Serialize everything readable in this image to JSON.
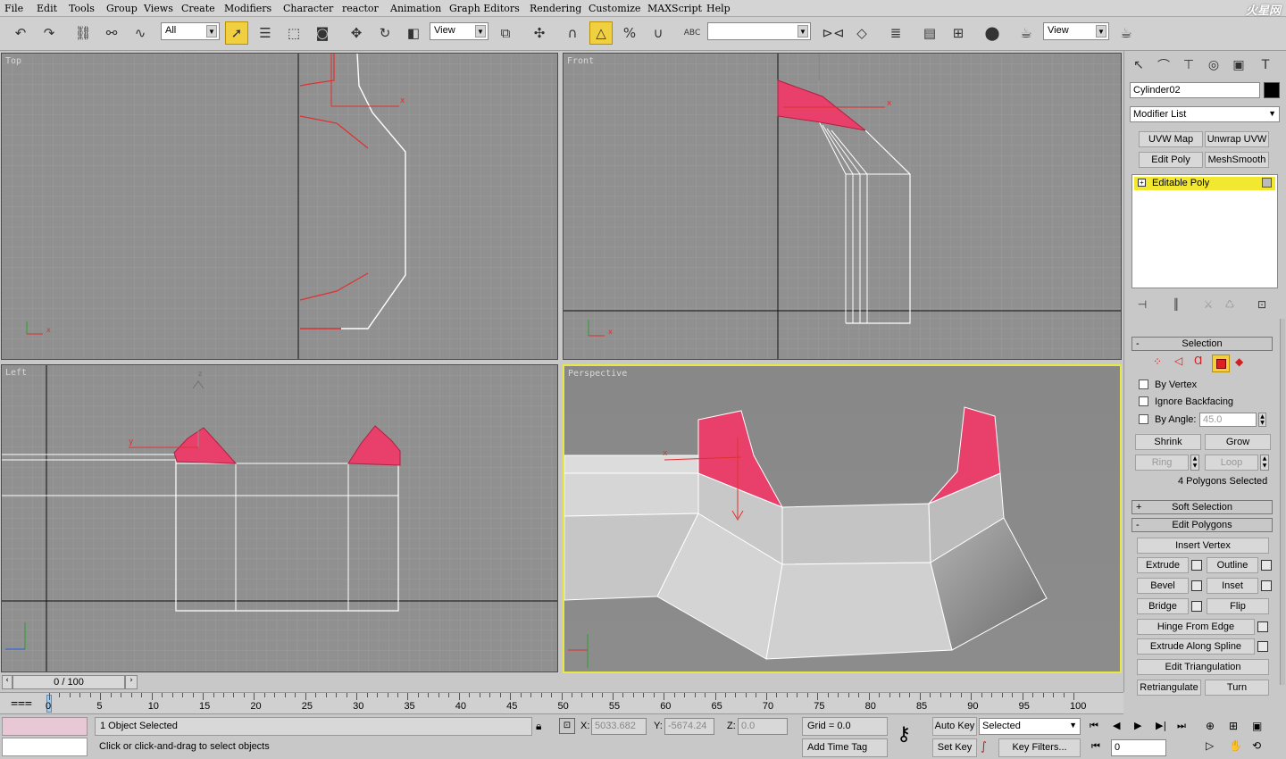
{
  "menu": [
    "File",
    "Edit",
    "Tools",
    "Group",
    "Views",
    "Create",
    "Modifiers",
    "Character",
    "reactor",
    "Animation",
    "Graph Editors",
    "Rendering",
    "Customize",
    "MAXScript",
    "Help"
  ],
  "logo_text": "火星网",
  "toolbar": {
    "selection_filter": "All",
    "ref_coord": "View",
    "named_sel": "",
    "render_view": "View",
    "abc_label": "ABC"
  },
  "viewports": {
    "top": "Top",
    "front": "Front",
    "left": "Left",
    "perspective": "Perspective"
  },
  "axis_labels": {
    "x": "x",
    "y": "y",
    "z": "z"
  },
  "command_panel": {
    "object_name": "Cylinder02",
    "color_swatch": "#000000",
    "modifier_list": "Modifier List",
    "buttons": [
      "UVW Map",
      "Unwrap UVW",
      "Edit Poly",
      "MeshSmooth"
    ],
    "stack_item": "Editable Poly",
    "selection_title": "Selection",
    "by_vertex": "By Vertex",
    "ignore_backfacing": "Ignore Backfacing",
    "by_angle": "By Angle:",
    "angle_value": "45.0",
    "shrink": "Shrink",
    "grow": "Grow",
    "ring": "Ring",
    "loop": "Loop",
    "selected_info": "4 Polygons Selected",
    "soft_selection": "Soft Selection",
    "edit_polygons": "Edit Polygons",
    "insert_vertex": "Insert Vertex",
    "extrude": "Extrude",
    "outline": "Outline",
    "bevel": "Bevel",
    "inset": "Inset",
    "bridge": "Bridge",
    "flip": "Flip",
    "hinge": "Hinge From Edge",
    "extrude_spline": "Extrude Along Spline",
    "edit_tri": "Edit Triangulation",
    "retriangulate": "Retriangulate",
    "turn": "Turn"
  },
  "timeline": {
    "frame": "0 / 100",
    "ticks": [
      "0",
      "5",
      "10",
      "15",
      "20",
      "25",
      "30",
      "35",
      "40",
      "45",
      "50",
      "55",
      "60",
      "65",
      "70",
      "75",
      "80",
      "85",
      "90",
      "95",
      "100"
    ]
  },
  "status": {
    "objects_selected": "1 Object Selected",
    "prompt": "Click or click-and-drag to select objects",
    "x_label": "X:",
    "x_value": "5033.682",
    "y_label": "Y:",
    "y_value": "-5674.24",
    "z_label": "Z:",
    "z_value": "0.0",
    "grid": "Grid = 0.0",
    "add_time_tag": "Add Time Tag",
    "auto_key": "Auto Key",
    "set_key": "Set Key",
    "key_mode": "Selected",
    "key_filters": "Key Filters...",
    "current_frame": "0"
  },
  "colors": {
    "selected_poly": "#e8406a",
    "active_border": "#e8e840",
    "viewport_bg": "#909090"
  }
}
